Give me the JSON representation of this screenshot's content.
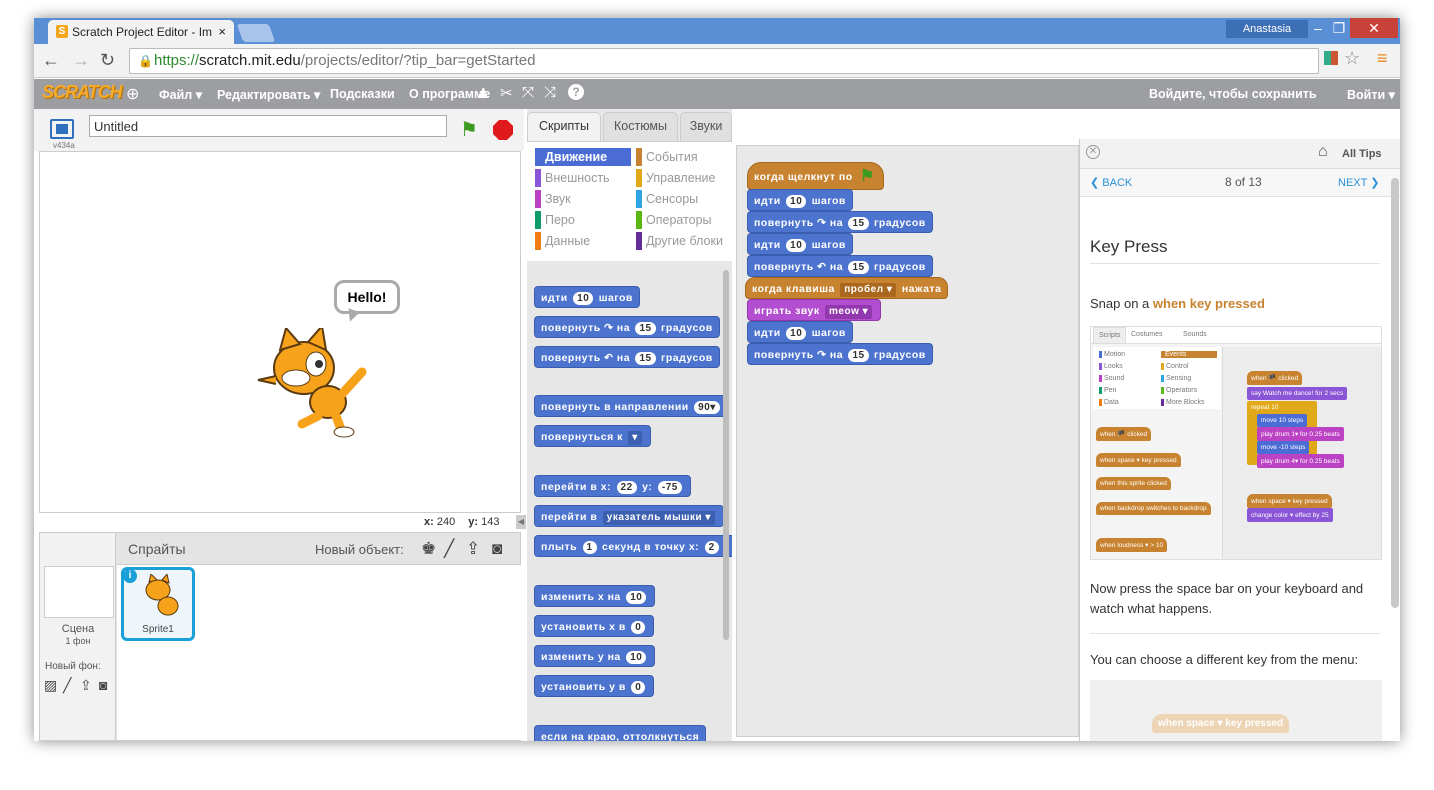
{
  "browser": {
    "tab_title": "Scratch Project Editor - Im",
    "tab_favicon": "S",
    "tab_close": "×",
    "user": "Anastasia",
    "url_proto": "https://",
    "url_host": "scratch.mit.edu",
    "url_path": "/projects/editor/?tip_bar=getStarted"
  },
  "menubar": {
    "logo": "SCRATCH",
    "file": "Файл ▾",
    "edit": "Редактировать ▾",
    "tips": "Подсказки",
    "about": "О программе",
    "signin_save": "Войдите, чтобы сохранить",
    "login": "Войти ▾"
  },
  "stage": {
    "version": "v434a",
    "title_value": "Untitled",
    "speech": "Hello!",
    "x_label": "x:",
    "x_value": "240",
    "y_label": "y:",
    "y_value": "143"
  },
  "sprites": {
    "header": "Спрайты",
    "new_object": "Новый объект:",
    "scene_label": "Сцена",
    "scene_sub": "1 фон",
    "new_backdrop": "Новый фон:",
    "sprite1": "Sprite1"
  },
  "tabs": {
    "scripts": "Скрипты",
    "costumes": "Костюмы",
    "sounds": "Звуки"
  },
  "categories": {
    "motion": "Движение",
    "looks": "Внешность",
    "sound": "Звук",
    "pen": "Перо",
    "data": "Данные",
    "events": "События",
    "control": "Управление",
    "sensing": "Сенсоры",
    "operators": "Операторы",
    "more": "Другие блоки"
  },
  "palette": {
    "b1": "идти",
    "b1n": "10",
    "b1t": "шагов",
    "b2": "повернуть ↷ на",
    "b2n": "15",
    "b2t": "градусов",
    "b3": "повернуть ↶ на",
    "b3n": "15",
    "b3t": "градусов",
    "b4": "повернуть в направлении",
    "b4n": "90▾",
    "b5": "повернуться к",
    "b5n": "▾",
    "b6": "перейти в x:",
    "b6n": "22",
    "b6y": "y:",
    "b6yn": "-75",
    "b7": "перейти в",
    "b7n": "указатель мышки ▾",
    "b8": "плыть",
    "b8n": "1",
    "b8t": "секунд в точку x:",
    "b8x": "2",
    "b9": "изменить x на",
    "b9n": "10",
    "b10": "установить x в",
    "b10n": "0",
    "b11": "изменить y на",
    "b11n": "10",
    "b12": "установить y в",
    "b12n": "0",
    "b13": "если на краю, оттолкнуться"
  },
  "script": {
    "hat": "когда щелкнут по",
    "s1": "идти",
    "s1n": "10",
    "s1t": "шагов",
    "s2": "повернуть ↷ на",
    "s2n": "15",
    "s2t": "градусов",
    "s3": "идти",
    "s3n": "10",
    "s3t": "шагов",
    "s4": "повернуть ↶ на",
    "s4n": "15",
    "s4t": "градусов",
    "hat2": "когда клавиша",
    "hat2n": "пробел ▾",
    "hat2t": "нажата",
    "s5": "играть звук",
    "s5n": "meow ▾",
    "s6": "идти",
    "s6n": "10",
    "s6t": "шагов",
    "s7": "повернуть ↷ на",
    "s7n": "15",
    "s7t": "градусов"
  },
  "tips": {
    "all_tips": "All Tips",
    "back": "BACK",
    "page": "8 of 13",
    "next": "NEXT",
    "title": "Key Press",
    "snap_prefix": "Snap on a ",
    "snap_block": "when key pressed",
    "p2": "Now press the space bar on your keyboard and watch what happens.",
    "p3": "You can choose a different key from the menu:",
    "img_tab_scripts": "Scripts",
    "img_tab_costumes": "Costumes",
    "img_tab_sounds": "Sounds",
    "img_cat_motion": "Motion",
    "img_cat_looks": "Looks",
    "img_cat_sound": "Sound",
    "img_cat_pen": "Pen",
    "img_cat_data": "Data",
    "img_cat_events": "Events",
    "img_cat_control": "Control",
    "img_cat_sensing": "Sensing",
    "img_cat_operators": "Operators",
    "img_cat_more": "More Blocks",
    "img_b1": "when 🏴 clicked",
    "img_b2": "when space ▾ key pressed",
    "img_b3": "when this sprite clicked",
    "img_b4": "when backdrop switches to backdrop",
    "img_b5": "when loudness ▾ > 10",
    "img_s1": "when 🏴 clicked",
    "img_s2": "say Watch me dance! for 2 secs",
    "img_s3": "repeat 10",
    "img_s4": "move 10 steps",
    "img_s5": "play drum 1▾ for 0.25 beats",
    "img_s6": "move -10 steps",
    "img_s7": "play drum 4▾ for 0.25 beats",
    "img_s8": "when space ▾ key pressed",
    "img_s9": "change color ▾ effect by 25",
    "faded": "when space ▾ key pressed"
  }
}
